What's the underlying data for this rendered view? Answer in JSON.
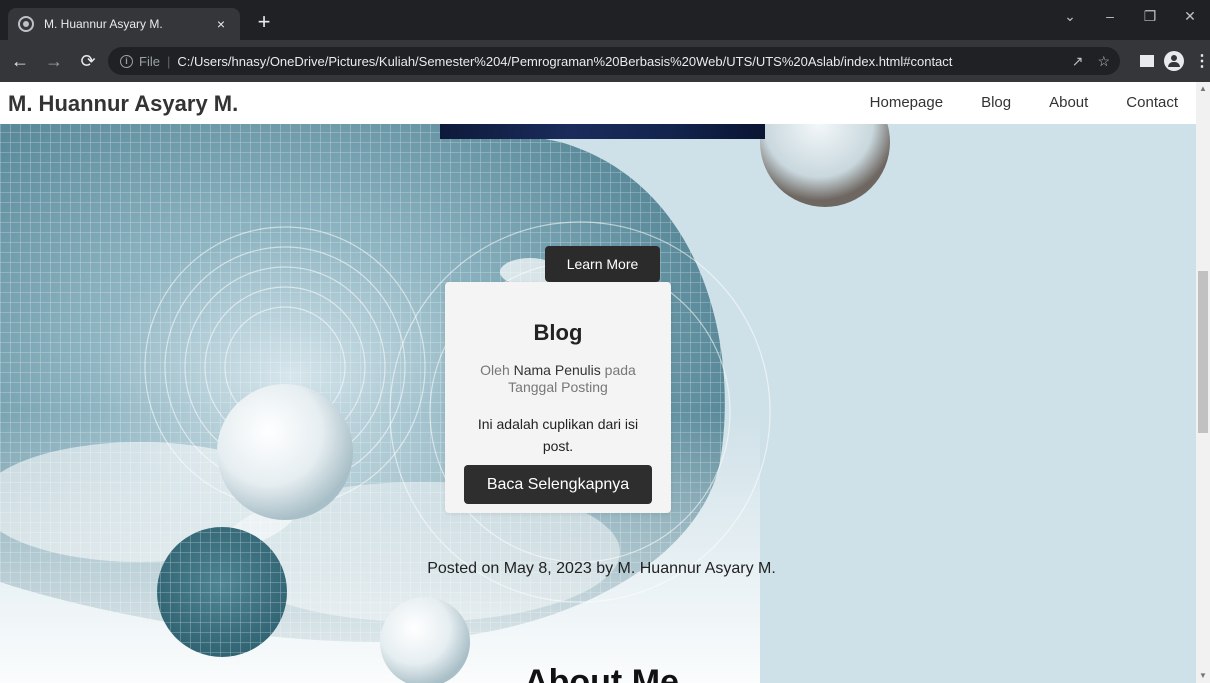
{
  "browser": {
    "tab_title": "M. Huannur Asyary M.",
    "tab_close": "×",
    "new_tab": "+",
    "scheme_label": "File",
    "url": "C:/Users/hnasy/OneDrive/Pictures/Kuliah/Semester%204/Pemrograman%20Berbasis%20Web/UTS/UTS%20Aslab/index.html#contact",
    "icons": [
      "back-icon",
      "forward-icon",
      "reload-icon",
      "info-icon",
      "share-icon",
      "star-icon",
      "side-panel-icon",
      "profile-icon",
      "menu-icon"
    ]
  },
  "site": {
    "title": "M. Huannur Asyary M.",
    "nav": [
      "Homepage",
      "Blog",
      "About",
      "Contact"
    ]
  },
  "hero": {
    "cta_label": "Learn More"
  },
  "blog_card": {
    "title": "Blog",
    "meta_prefix": "Oleh ",
    "author": "Nama Penulis",
    "meta_middle": " pada",
    "date": "Tanggal Posting",
    "excerpt": "Ini adalah cuplikan dari isi post.",
    "read_more_label": "Baca Selengkapnya"
  },
  "post_meta": "Posted on May 8, 2023 by M. Huannur Asyary M.",
  "about": {
    "heading": "About Me"
  },
  "colors": {
    "chrome_dark": "#202124",
    "chrome_toolbar": "#35363a",
    "header_bg": "#ffffff",
    "button_dark": "#2b2b2b",
    "card_bg": "#f4f4f4",
    "bg_light": "#cfe1e8",
    "bg_teal": "#5d8d9c"
  }
}
